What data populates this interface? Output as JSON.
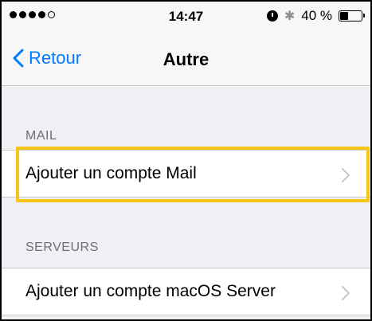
{
  "status_bar": {
    "time": "14:47",
    "battery_text": "40 %",
    "icons": [
      "signal-dots",
      "alarm-icon",
      "bluetooth-icon",
      "battery-icon"
    ]
  },
  "nav": {
    "back_label": "Retour",
    "title": "Autre"
  },
  "sections": [
    {
      "header": "MAIL",
      "items": [
        {
          "label": "Ajouter un compte Mail",
          "highlighted": true
        }
      ]
    },
    {
      "header": "SERVEURS",
      "items": [
        {
          "label": "Ajouter un compte macOS Server",
          "highlighted": false
        }
      ]
    }
  ],
  "colors": {
    "accent": "#007aff",
    "highlight": "#f5c518",
    "background": "#efeff4"
  }
}
